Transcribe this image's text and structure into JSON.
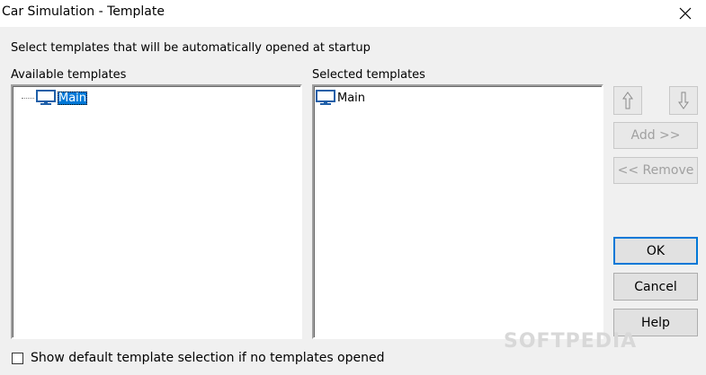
{
  "window": {
    "title": "Car Simulation - Template",
    "close_icon": "close-icon"
  },
  "instruction": "Select templates that will be automatically opened at startup",
  "available": {
    "label": "Available templates",
    "items": [
      {
        "label": "Main",
        "icon": "monitor-icon",
        "selected": true
      }
    ]
  },
  "selected": {
    "label": "Selected templates",
    "items": [
      {
        "label": "Main",
        "icon": "monitor-icon"
      }
    ]
  },
  "buttons": {
    "move_up_icon": "arrow-up-icon",
    "move_down_icon": "arrow-down-icon",
    "add": "Add >>",
    "remove": "<< Remove",
    "ok": "OK",
    "cancel": "Cancel",
    "help": "Help"
  },
  "checkbox": {
    "label": "Show default template selection if no templates opened",
    "checked": false
  },
  "watermark": "SOFTPEDIA"
}
